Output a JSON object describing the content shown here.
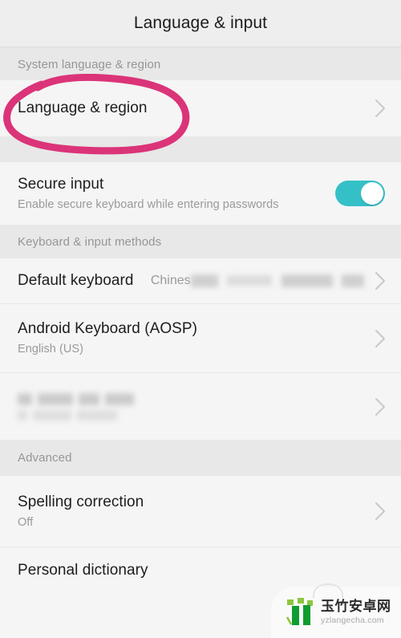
{
  "header": {
    "title": "Language & input"
  },
  "sections": [
    {
      "id": "system-language-region",
      "label": "System language & region",
      "rows": [
        {
          "id": "language-region",
          "title": "Language & region",
          "subtitle": "",
          "value": "",
          "accessory": "chevron",
          "annotated": true
        }
      ]
    },
    {
      "id": "secure-input-group",
      "label": "",
      "rows": [
        {
          "id": "secure-input",
          "title": "Secure input",
          "subtitle": "Enable secure keyboard while entering passwords",
          "value": "",
          "accessory": "toggle",
          "toggle_on": true
        }
      ]
    },
    {
      "id": "keyboard-input-methods",
      "label": "Keyboard & input methods",
      "rows": [
        {
          "id": "default-keyboard",
          "title": "Default keyboard",
          "subtitle": "",
          "value": "Chines",
          "value_redacted": true,
          "accessory": "chevron"
        },
        {
          "id": "android-keyboard-aosp",
          "title": "Android Keyboard (AOSP)",
          "subtitle": "English (US)",
          "value": "",
          "accessory": "chevron"
        },
        {
          "id": "redacted-keyboard",
          "title": "",
          "subtitle": "",
          "value": "",
          "title_redacted": true,
          "accessory": "chevron"
        }
      ]
    },
    {
      "id": "advanced",
      "label": "Advanced",
      "rows": [
        {
          "id": "spelling-correction",
          "title": "Spelling correction",
          "subtitle": "Off",
          "value": "",
          "accessory": "chevron"
        },
        {
          "id": "personal-dictionary",
          "title": "Personal dictionary",
          "subtitle": "",
          "value": "",
          "accessory": "none"
        }
      ]
    }
  ],
  "annotation": {
    "shape": "hand-drawn-ellipse",
    "color": "#db3478",
    "target": "Language & region"
  },
  "watermark": {
    "title": "玉竹安卓网",
    "url": "yzlangecha.com"
  },
  "colors": {
    "toggle_on": "#35c0c8",
    "annotation_pink": "#db3478",
    "row_bg": "#f5f5f5",
    "section_bg": "#e8e8e8",
    "title_bg": "#eeeeee"
  }
}
